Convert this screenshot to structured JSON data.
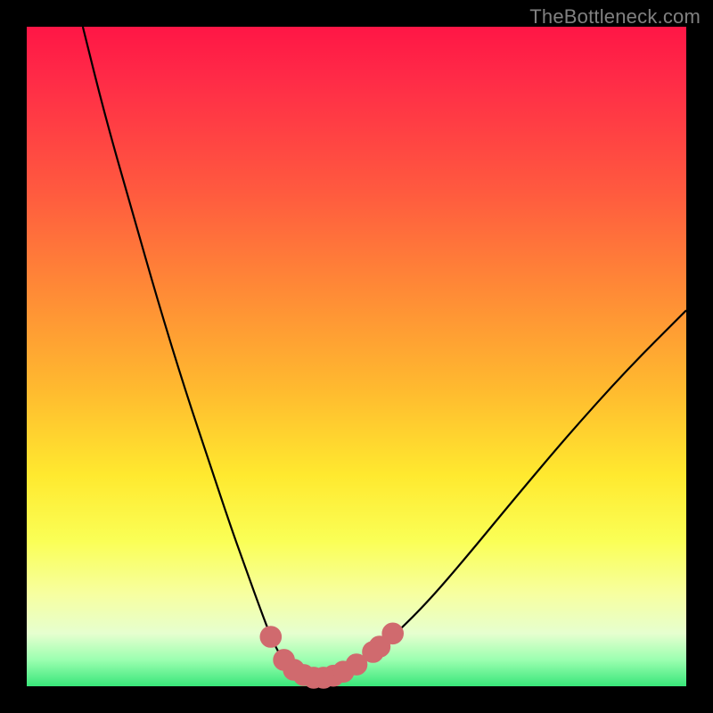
{
  "watermark": "TheBottleneck.com",
  "colors": {
    "background": "#000000",
    "gradient_top": "#ff1646",
    "gradient_mid1": "#ff8a36",
    "gradient_mid2": "#ffe92f",
    "gradient_bottom": "#39e67a",
    "curve_stroke": "#000000",
    "marker_fill": "#d06a6e",
    "marker_stroke": "#d06a6e"
  },
  "chart_data": {
    "type": "line",
    "title": "",
    "xlabel": "",
    "ylabel": "",
    "xlim": [
      0,
      100
    ],
    "ylim": [
      0,
      100
    ],
    "series": [
      {
        "name": "curve",
        "x": [
          8.5,
          12,
          16,
          20,
          24,
          28,
          31,
          33.5,
          35.5,
          37,
          38.5,
          40,
          41.5,
          43,
          44.5,
          46.5,
          49,
          52,
          56,
          61,
          67,
          74,
          82,
          91,
          100
        ],
        "y": [
          100,
          86,
          72,
          58,
          45,
          33,
          24,
          17,
          11.5,
          7.5,
          4.5,
          2.5,
          1.5,
          1.2,
          1.2,
          1.5,
          2.5,
          4.5,
          8,
          13,
          20,
          28.5,
          38,
          48,
          57
        ]
      }
    ],
    "markers": [
      {
        "x": 37.0,
        "y": 7.5,
        "r": 1.6
      },
      {
        "x": 39.0,
        "y": 4.0,
        "r": 1.6
      },
      {
        "x": 40.5,
        "y": 2.5,
        "r": 1.6
      },
      {
        "x": 42.0,
        "y": 1.7,
        "r": 1.6
      },
      {
        "x": 43.5,
        "y": 1.3,
        "r": 1.6
      },
      {
        "x": 45.0,
        "y": 1.3,
        "r": 1.6
      },
      {
        "x": 46.5,
        "y": 1.6,
        "r": 1.6
      },
      {
        "x": 48.0,
        "y": 2.2,
        "r": 1.6
      },
      {
        "x": 50.0,
        "y": 3.3,
        "r": 1.6
      },
      {
        "x": 52.5,
        "y": 5.2,
        "r": 1.6
      },
      {
        "x": 53.5,
        "y": 6.0,
        "r": 1.6
      },
      {
        "x": 55.5,
        "y": 8.0,
        "r": 1.6
      }
    ]
  }
}
